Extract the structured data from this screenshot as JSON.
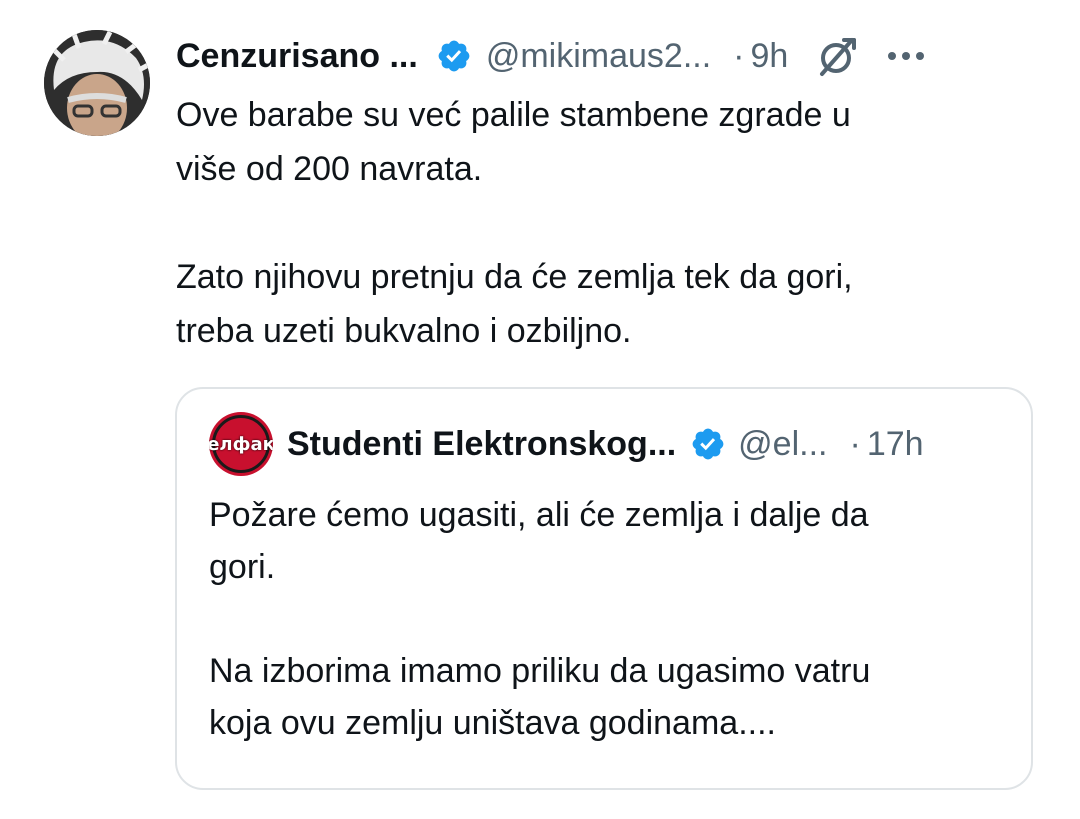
{
  "tweet": {
    "display_name": "Cenzurisano ...",
    "handle": "@mikimaus2...",
    "separator": "·",
    "time": "9h",
    "text_lines": [
      "Ove barabe su već palile stambene zgrade u",
      "više od 200 navrata.",
      "Zato njihovu pretnju da će zemlja tek da gori,",
      "treba uzeti bukvalno i ozbiljno."
    ]
  },
  "quoted": {
    "avatar_text": "елфак",
    "display_name": "Studenti Elektronskog...",
    "handle": "@el...",
    "separator": "·",
    "time": "17h",
    "text_lines": [
      "Požare ćemo ugasiti, ali će zemlja i dalje da",
      "gori.",
      "Na izborima imamo priliku da ugasimo vatru",
      "koja ovu zemlju uništava godinama...."
    ]
  },
  "colors": {
    "verified": "#1d9bf0",
    "secondary_text": "#536471",
    "border": "#dfe3e6"
  },
  "icons": {
    "verified": "verified-badge-icon",
    "grok": "grok-icon",
    "more": "more-options-icon"
  }
}
